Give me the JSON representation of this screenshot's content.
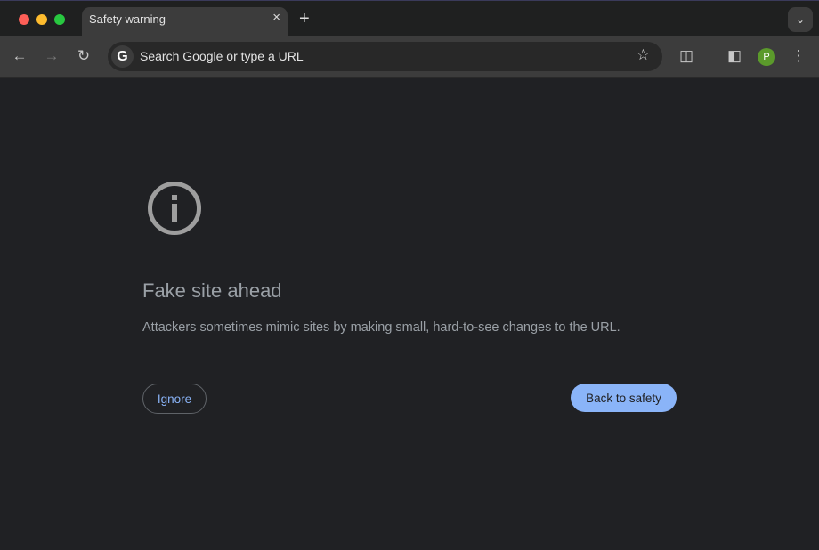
{
  "browser": {
    "tab_title": "Safety warning",
    "close_icon": "×",
    "new_tab_icon": "+",
    "omnibox_placeholder": "Search Google or type a URL",
    "profile_initial": "P",
    "colors": {
      "close": "#fe5f57",
      "minimize": "#febc2e",
      "zoom": "#28c840",
      "accent": "#8ab4f8",
      "avatar": "#5b9a2b"
    }
  },
  "page": {
    "title": "Fake site ahead",
    "description": "Attackers sometimes mimic sites by making small, hard-to-see changes to the URL.",
    "ignore_label": "Ignore",
    "back_label": "Back to safety"
  }
}
